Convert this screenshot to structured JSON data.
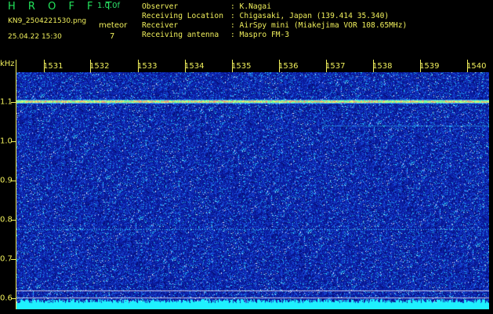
{
  "header": {
    "program": "H R O F F T",
    "version": "1.0.0f",
    "filename": "KN9_2504221530.png",
    "timestamp": "25.04.22 15:30",
    "meteor_label": "meteor",
    "meteor_count": "7",
    "info": [
      {
        "label": "Observer",
        "value": ": K.Nagai"
      },
      {
        "label": "Receiving Location",
        "value": ": Chigasaki, Japan (139.414 35.340)"
      },
      {
        "label": "Receiver",
        "value": ": AirSpy mini (Miakejima VOR 108.65MHz)"
      },
      {
        "label": "Receiving antenna",
        "value": ": Maspro FM-3"
      }
    ]
  },
  "axes": {
    "y_unit": "kHz",
    "x_ticks": [
      "1531",
      "1532",
      "1533",
      "1534",
      "1535",
      "1536",
      "1537",
      "1538",
      "1539",
      "1540"
    ],
    "y_ticks": [
      "1.1",
      "1.0",
      "0.9",
      "0.8",
      "0.7",
      "0.6"
    ]
  },
  "colors": {
    "background": "#000000",
    "text": "#f0ef5c",
    "title": "#22e35a",
    "plot_base": "#0a1a9a",
    "noise_floor": "#1ff0ff"
  }
}
